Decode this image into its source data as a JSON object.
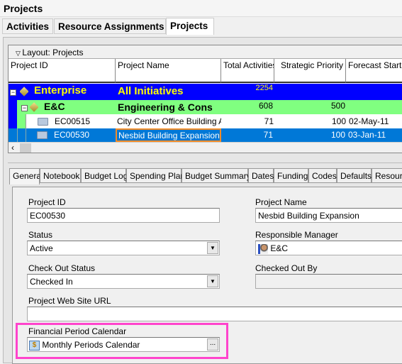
{
  "title": "Projects",
  "main_tabs": [
    {
      "label": "Activities"
    },
    {
      "label": "Resource Assignments"
    },
    {
      "label": "Projects",
      "active": true
    }
  ],
  "grid": {
    "layout_label": "Layout: Projects",
    "columns": [
      "Project ID",
      "Project Name",
      "Total Activities",
      "Strategic Priority",
      "Forecast Start D"
    ],
    "rows": [
      {
        "id": "Enterprise",
        "name": "All  Initiatives",
        "total": "2254",
        "priority": "",
        "start": "",
        "color": "#0000ff"
      },
      {
        "id": "E&C",
        "name": "Engineering & Cons",
        "total": "608",
        "priority": "500",
        "start": "",
        "color": "#80ff80"
      },
      {
        "id": "EC00515",
        "name": "City Center Office Building Adc",
        "total": "71",
        "priority": "100",
        "start": "02-May-11"
      },
      {
        "id": "EC00530",
        "name": "Nesbid Building Expansion",
        "total": "71",
        "priority": "100",
        "start": "03-Jan-11",
        "selected": true
      }
    ]
  },
  "detail_tabs": [
    {
      "label": "General",
      "active": true
    },
    {
      "label": "Notebook"
    },
    {
      "label": "Budget Log"
    },
    {
      "label": "Spending Plan"
    },
    {
      "label": "Budget Summary"
    },
    {
      "label": "Dates"
    },
    {
      "label": "Funding"
    },
    {
      "label": "Codes"
    },
    {
      "label": "Defaults"
    },
    {
      "label": "Resour"
    }
  ],
  "form": {
    "project_id_label": "Project ID",
    "project_id": "EC00530",
    "project_name_label": "Project Name",
    "project_name": "Nesbid Building Expansion",
    "status_label": "Status",
    "status": "Active",
    "manager_label": "Responsible Manager",
    "manager": "E&C",
    "checkout_status_label": "Check Out Status",
    "checkout_status": "Checked In",
    "checked_out_by_label": "Checked Out By",
    "checked_out_by": "",
    "url_label": "Project Web Site URL",
    "url": "",
    "calendar_label": "Financial Period Calendar",
    "calendar": "Monthly Periods Calendar",
    "browse": "..."
  },
  "colors": {
    "highlight": "#ff44cc",
    "selection": "#0078d7",
    "enterprise": "#0000ff",
    "eps": "#80ff80"
  }
}
